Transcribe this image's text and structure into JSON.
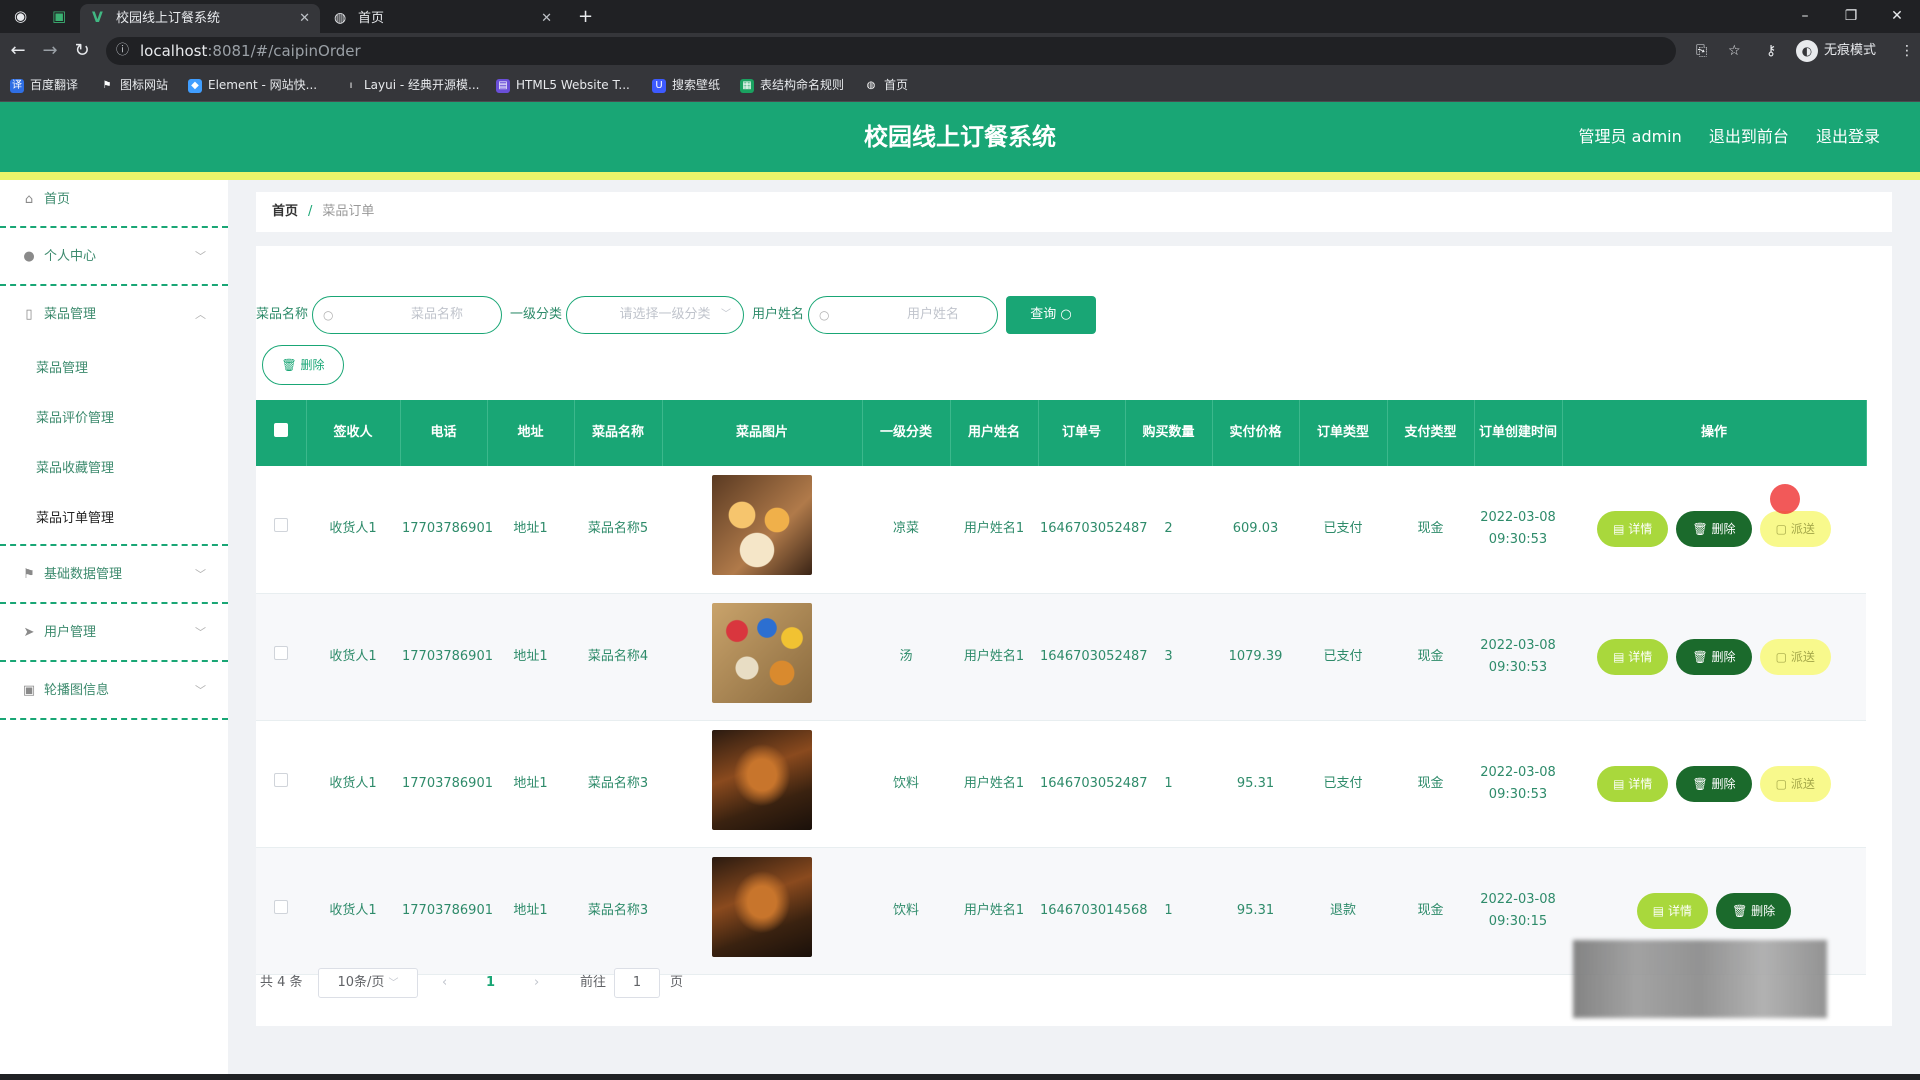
{
  "browser": {
    "tabs": [
      {
        "title": "校园线上订餐系统",
        "active": true
      },
      {
        "title": "首页",
        "active": false
      }
    ],
    "address": {
      "host": "localhost",
      "path": ":8081/#/caipinOrder"
    },
    "profile": "无痕模式",
    "bookmarks": [
      "百度翻译",
      "图标网站",
      "Element - 网站快...",
      "Layui - 经典开源模...",
      "HTML5 Website T...",
      "搜索壁纸",
      "表结构命名规则",
      "首页"
    ]
  },
  "header": {
    "title": "校园线上订餐系统",
    "links": [
      "管理员 admin",
      "退出到前台",
      "退出登录"
    ]
  },
  "sidebar": {
    "home": "首页",
    "groups": [
      {
        "label": "个人中心"
      },
      {
        "label": "菜品管理",
        "children": [
          "菜品管理",
          "菜品评价管理",
          "菜品收藏管理",
          "菜品订单管理"
        ]
      },
      {
        "label": "基础数据管理"
      },
      {
        "label": "用户管理"
      },
      {
        "label": "轮播图信息"
      }
    ]
  },
  "breadcrumb": {
    "home": "首页",
    "separator": "/",
    "current": "菜品订单"
  },
  "search": {
    "dish_label": "菜品名称",
    "dish_placeholder": "菜品名称",
    "category_label": "一级分类",
    "category_placeholder": "请选择一级分类",
    "user_label": "用户姓名",
    "user_placeholder": "用户姓名",
    "query_button": "查询",
    "delete_button": "删除"
  },
  "table": {
    "headers": [
      "签收人",
      "电话",
      "地址",
      "菜品名称",
      "菜品图片",
      "一级分类",
      "用户姓名",
      "订单号",
      "购买数量",
      "实付价格",
      "订单类型",
      "支付类型",
      "订单创建时间",
      "操作"
    ],
    "rows": [
      {
        "receiver": "收货人1",
        "phone": "17703786901",
        "address": "地址1",
        "dish": "菜品名称5",
        "category": "凉菜",
        "user": "用户姓名1",
        "order_no": "1646703052487",
        "qty": "2",
        "price": "609.03",
        "order_type": "已支付",
        "pay_type": "现金",
        "created": "2022-03-08 09:30:53",
        "actions": [
          "详情",
          "删除",
          "派送"
        ]
      },
      {
        "receiver": "收货人1",
        "phone": "17703786901",
        "address": "地址1",
        "dish": "菜品名称4",
        "category": "汤",
        "user": "用户姓名1",
        "order_no": "1646703052487",
        "qty": "3",
        "price": "1079.39",
        "order_type": "已支付",
        "pay_type": "现金",
        "created": "2022-03-08 09:30:53",
        "actions": [
          "详情",
          "删除",
          "派送"
        ]
      },
      {
        "receiver": "收货人1",
        "phone": "17703786901",
        "address": "地址1",
        "dish": "菜品名称3",
        "category": "饮料",
        "user": "用户姓名1",
        "order_no": "1646703052487",
        "qty": "1",
        "price": "95.31",
        "order_type": "已支付",
        "pay_type": "现金",
        "created": "2022-03-08 09:30:53",
        "actions": [
          "详情",
          "删除",
          "派送"
        ]
      },
      {
        "receiver": "收货人1",
        "phone": "17703786901",
        "address": "地址1",
        "dish": "菜品名称3",
        "category": "饮料",
        "user": "用户姓名1",
        "order_no": "1646703014568",
        "qty": "1",
        "price": "95.31",
        "order_type": "退款",
        "pay_type": "现金",
        "created": "2022-03-08 09:30:15",
        "actions": [
          "详情",
          "删除"
        ]
      }
    ]
  },
  "pagination": {
    "total": "共 4 条",
    "page_size": "10条/页",
    "current_page": "1",
    "goto_label": "前往",
    "goto_value": "1",
    "page_suffix": "页"
  },
  "colors": {
    "primary": "#19a675",
    "accent_yellow": "#ecf56a",
    "detail_btn": "#a9d83c",
    "delete_btn": "#1b6a2c",
    "send_btn": "#f8f98c"
  }
}
